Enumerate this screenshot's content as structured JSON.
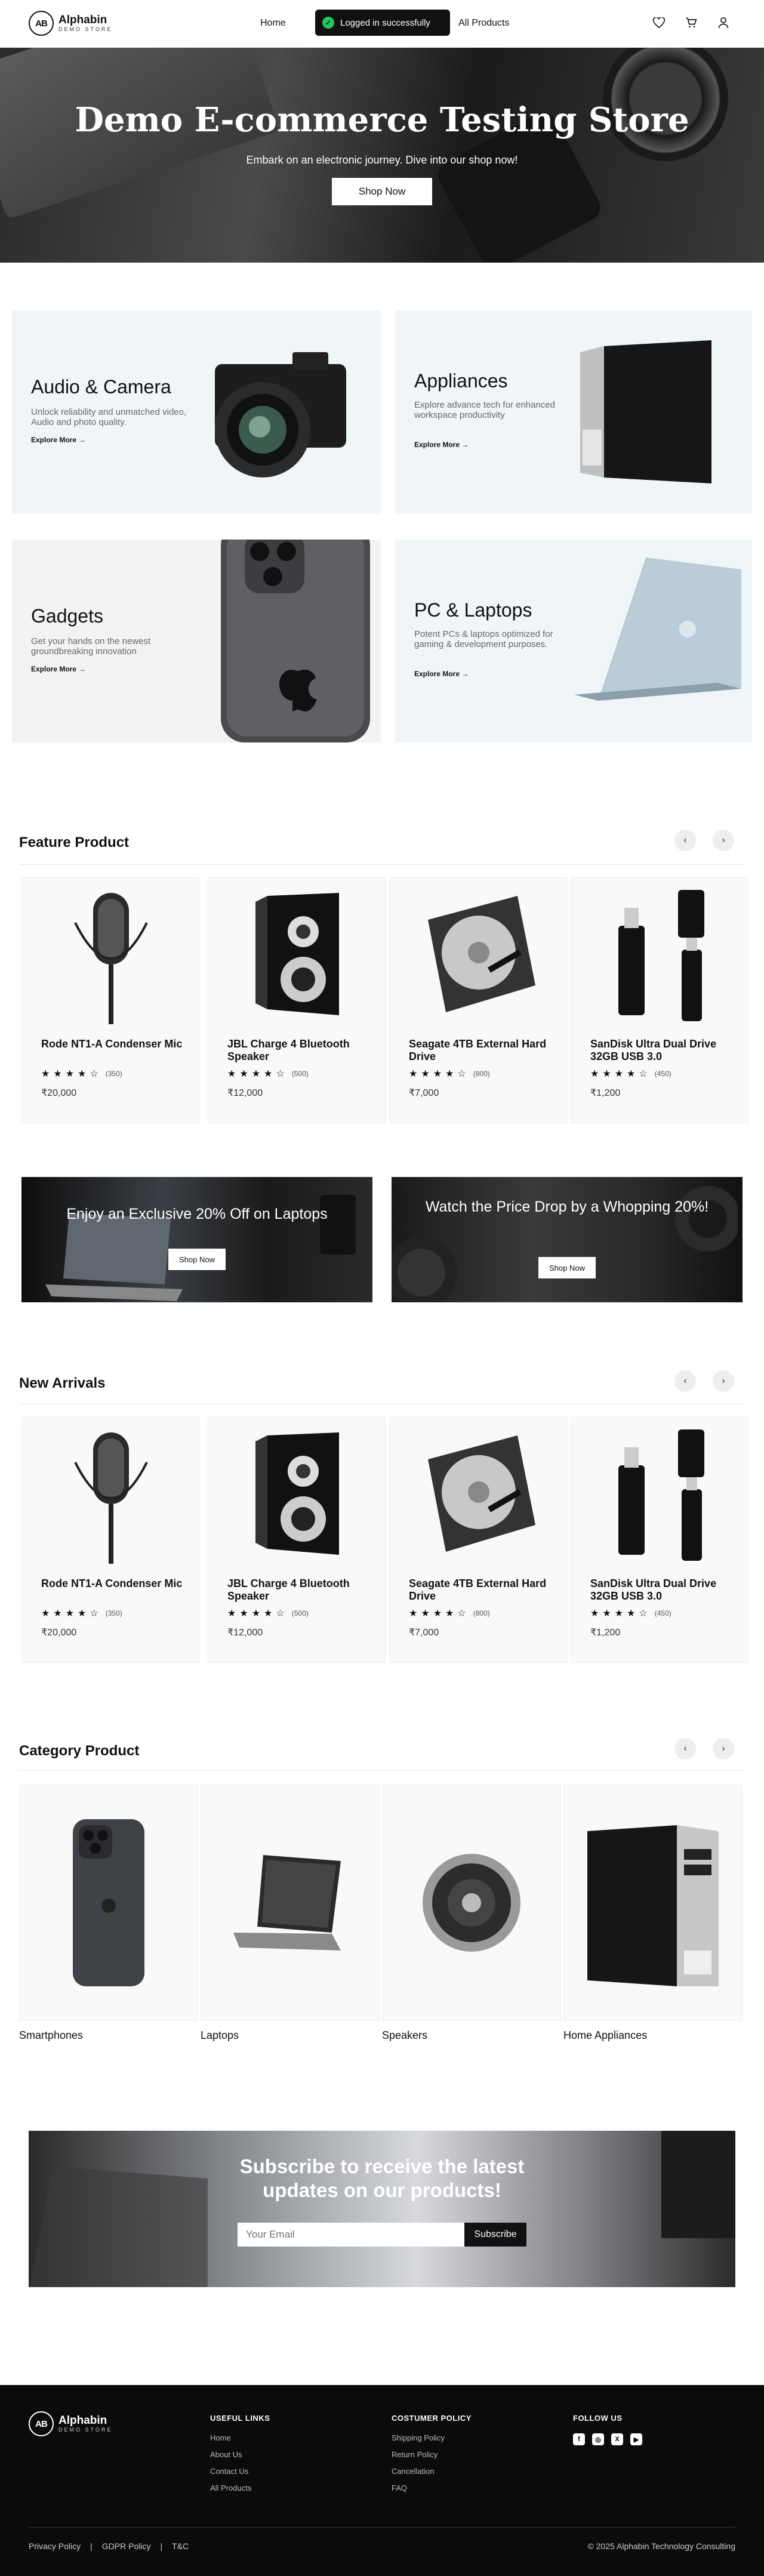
{
  "header": {
    "logo_title": "Alphabin",
    "logo_subtitle": "DEMO STORE",
    "logo_mark": "AB",
    "nav_home": "Home",
    "toast": "Logged in successfully",
    "nav_all_products": "All Products",
    "icons": [
      "heart-icon",
      "cart-icon",
      "user-icon"
    ]
  },
  "hero": {
    "title": "Demo E-commerce Testing Store",
    "subtitle": "Embark on an electronic journey. Dive into our shop now!",
    "button": "Shop Now"
  },
  "categories": [
    {
      "title": "Audio & Camera",
      "description": "Unlock reliability and unmatched video, Audio and photo quality.",
      "link": "Explore More"
    },
    {
      "title": "Appliances",
      "description": "Explore advance tech for enhanced workspace productivity",
      "link": "Explore More"
    },
    {
      "title": "Gadgets",
      "description": "Get your hands on the newest groundbreaking innovation",
      "link": "Explore More"
    },
    {
      "title": "PC & Laptops",
      "description": "Potent PCs & laptops optimized for gaming & development purposes.",
      "link": "Explore More"
    }
  ],
  "featured": {
    "title": "Feature Product",
    "products": [
      {
        "name": "Rode NT1-A Condenser Mic",
        "rating": 4,
        "count": "(350)",
        "price": "₹20,000"
      },
      {
        "name": "JBL Charge 4 Bluetooth Speaker",
        "rating": 4,
        "count": "(500)",
        "price": "₹12,000"
      },
      {
        "name": "Seagate 4TB External Hard Drive",
        "rating": 4,
        "count": "(800)",
        "price": "₹7,000"
      },
      {
        "name": "SanDisk Ultra Dual Drive 32GB USB 3.0",
        "rating": 4,
        "count": "(450)",
        "price": "₹1,200"
      }
    ]
  },
  "promos": [
    {
      "title": "Enjoy an Exclusive 20% Off on Laptops",
      "button": "Shop Now"
    },
    {
      "title": "Watch the Price Drop by a Whopping 20%!",
      "button": "Shop Now"
    }
  ],
  "new_arrivals": {
    "title": "New Arrivals",
    "products": [
      {
        "name": "Rode NT1-A Condenser Mic",
        "rating": 4,
        "count": "(350)",
        "price": "₹20,000"
      },
      {
        "name": "JBL Charge 4 Bluetooth Speaker",
        "rating": 4,
        "count": "(500)",
        "price": "₹12,000"
      },
      {
        "name": "Seagate 4TB External Hard Drive",
        "rating": 4,
        "count": "(800)",
        "price": "₹7,000"
      },
      {
        "name": "SanDisk Ultra Dual Drive 32GB USB 3.0",
        "rating": 4,
        "count": "(450)",
        "price": "₹1,200"
      }
    ]
  },
  "category_products": {
    "title": "Category Product",
    "items": [
      "Smartphones",
      "Laptops",
      "Speakers",
      "Home Appliances"
    ]
  },
  "subscribe": {
    "title_line1": "Subscribe to receive the latest",
    "title_line2": "updates on our products!",
    "placeholder": "Your Email",
    "button": "Subscribe"
  },
  "footer": {
    "useful_links": {
      "title": "USEFUL LINKS",
      "items": [
        "Home",
        "About Us",
        "Contact Us",
        "All Products"
      ]
    },
    "customer_policy": {
      "title": "COSTUMER POLICY",
      "items": [
        "Shipping Policy",
        "Return Policy",
        "Cancellation",
        "FAQ"
      ]
    },
    "follow_us": {
      "title": "FOLLOW US",
      "icons": [
        "facebook-icon",
        "instagram-icon",
        "x-icon",
        "youtube-icon"
      ]
    },
    "bottom_links": [
      "Privacy Policy",
      "GDPR Policy",
      "T&C"
    ],
    "separator": "|",
    "copyright": "© 2025 Alphabin Technology Consulting"
  },
  "colors": {
    "accent": "#111111",
    "toast_success": "#22c55e",
    "card_bg": "#f0f6f8",
    "footer_bg": "#0b0b0b"
  }
}
